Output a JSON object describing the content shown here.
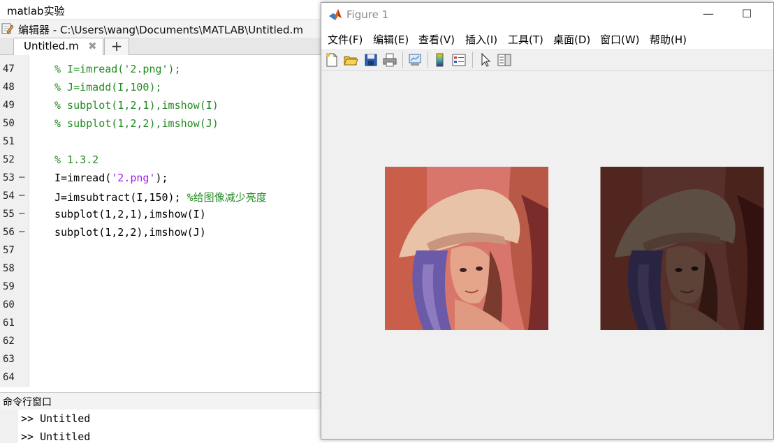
{
  "editor_window": {
    "title": "matlab实验",
    "header_text": "编辑器 - C:\\Users\\wang\\Documents\\MATLAB\\Untitled.m",
    "tabs": [
      {
        "label": "Untitled.m",
        "close": "✖"
      }
    ],
    "add_tab": "+",
    "lines": [
      {
        "num": "47",
        "dash": "",
        "parts": [
          {
            "t": "% I=imread('2.png');",
            "c": "cmt"
          }
        ]
      },
      {
        "num": "48",
        "dash": "",
        "parts": [
          {
            "t": "% J=imadd(I,100);",
            "c": "cmt"
          }
        ]
      },
      {
        "num": "49",
        "dash": "",
        "parts": [
          {
            "t": "% subplot(1,2,1),imshow(I)",
            "c": "cmt"
          }
        ]
      },
      {
        "num": "50",
        "dash": "",
        "parts": [
          {
            "t": "% subplot(1,2,2),imshow(J)",
            "c": "cmt"
          }
        ]
      },
      {
        "num": "51",
        "dash": "",
        "parts": []
      },
      {
        "num": "52",
        "dash": "",
        "parts": [
          {
            "t": "% 1.3.2",
            "c": "cmt"
          }
        ]
      },
      {
        "num": "53",
        "dash": "—",
        "parts": [
          {
            "t": "I=imread(",
            "c": "blk"
          },
          {
            "t": "'2.png'",
            "c": "str"
          },
          {
            "t": ");",
            "c": "blk"
          }
        ]
      },
      {
        "num": "54",
        "dash": "—",
        "parts": [
          {
            "t": "J=imsubtract(I,150); ",
            "c": "blk"
          },
          {
            "t": "%给图像减少亮度",
            "c": "cmt"
          }
        ]
      },
      {
        "num": "55",
        "dash": "—",
        "parts": [
          {
            "t": "subplot(1,2,1),imshow(I)",
            "c": "blk"
          }
        ]
      },
      {
        "num": "56",
        "dash": "—",
        "parts": [
          {
            "t": "subplot(1,2,2),imshow(J)",
            "c": "blk"
          }
        ]
      },
      {
        "num": "57",
        "dash": "",
        "parts": []
      },
      {
        "num": "58",
        "dash": "",
        "parts": []
      },
      {
        "num": "59",
        "dash": "",
        "parts": []
      },
      {
        "num": "60",
        "dash": "",
        "parts": []
      },
      {
        "num": "61",
        "dash": "",
        "parts": []
      },
      {
        "num": "62",
        "dash": "",
        "parts": []
      },
      {
        "num": "63",
        "dash": "",
        "parts": []
      },
      {
        "num": "64",
        "dash": "",
        "parts": []
      }
    ]
  },
  "command_window": {
    "title": "命令行窗口",
    "lines": [
      ">> Untitled",
      ">> Untitled"
    ]
  },
  "figure_window": {
    "title": "Figure 1",
    "minimize": "—",
    "maximize": "☐",
    "menu": [
      "文件(F)",
      "编辑(E)",
      "查看(V)",
      "插入(I)",
      "工具(T)",
      "桌面(D)",
      "窗口(W)",
      "帮助(H)"
    ],
    "toolbar_icons": [
      "new-figure-icon",
      "open-file-icon",
      "save-icon",
      "print-icon",
      "link-plot-icon",
      "colorbar-icon",
      "legend-icon",
      "select-arrow-icon",
      "property-editor-icon"
    ],
    "subplots": [
      {
        "name": "original-image",
        "brightness": 1.0
      },
      {
        "name": "darkened-image",
        "brightness": 0.4
      }
    ]
  }
}
